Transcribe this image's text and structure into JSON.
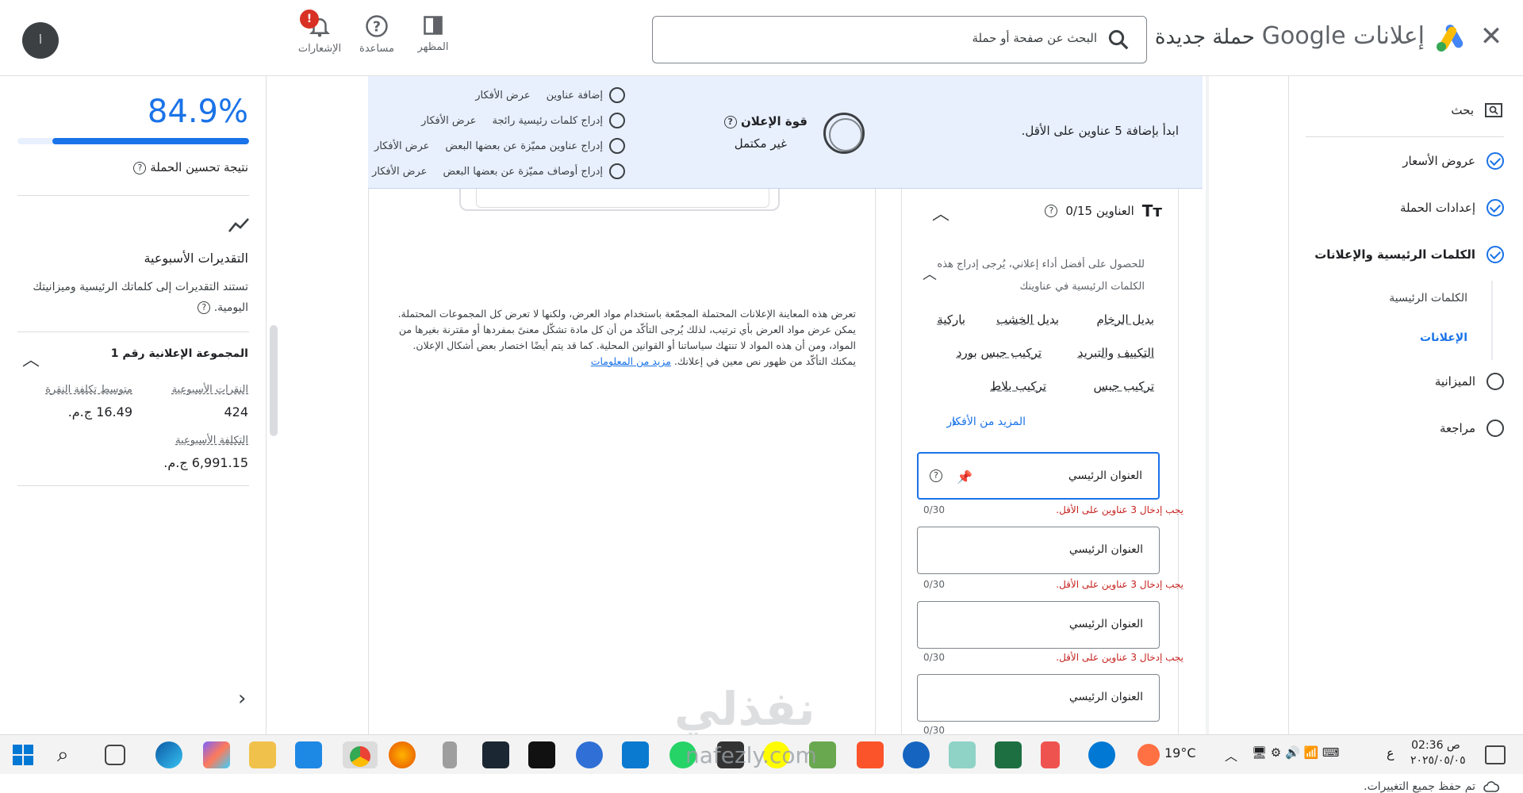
{
  "header": {
    "brand_google": "Google",
    "brand_product": "إعلانات",
    "page_title": "حملة جديدة",
    "search_placeholder": "البحث عن صفحة أو حملة",
    "tools": [
      {
        "label": "المظهر",
        "icon": "appearance-icon"
      },
      {
        "label": "مساعدة",
        "icon": "help-icon"
      },
      {
        "label": "الإشعارات",
        "icon": "bell-icon"
      }
    ],
    "notification_badge": "!",
    "avatar_initials": "أ"
  },
  "nav": {
    "items": [
      {
        "label": "بحث",
        "state": "search"
      },
      {
        "label": "عروض الأسعار",
        "state": "done"
      },
      {
        "label": "إعدادات الحملة",
        "state": "done"
      },
      {
        "label": "الكلمات الرئيسية والإعلانات",
        "state": "current"
      },
      {
        "label": "الميزانية",
        "state": "todo"
      },
      {
        "label": "مراجعة",
        "state": "todo"
      }
    ],
    "subitems": [
      {
        "label": "الكلمات الرئيسية",
        "active": false
      },
      {
        "label": "الإعلانات",
        "active": true
      }
    ],
    "saved_text": "تم حفظ جميع التغييرات."
  },
  "sidebar": {
    "optimization_score": "84.9%",
    "optimization_score_value": 84.9,
    "optimization_label": "نتيجة تحسين الحملة",
    "weekly_title": "التقديرات الأسبوعية",
    "weekly_desc_line1": "تستند التقديرات إلى كلماتك الرئيسية وميزانيتك",
    "weekly_desc_line2": "اليومية.",
    "ad_group": "المجموعة الإعلانية رقم 1",
    "stats": [
      {
        "label": "النقرات الأسبوعية",
        "value": "424"
      },
      {
        "label": "متوسط تكلفة النقرة",
        "value": "16.49 ج.م."
      },
      {
        "label": "التكلفة الأسبوعية",
        "value": "6,991.15 ج.م."
      }
    ]
  },
  "banner": {
    "start_text": "ابدأ بإضافة 5 عناوين على الأقل.",
    "strength_title": "قوة الإعلان",
    "strength_value": "غير مكتمل",
    "suggestions": [
      {
        "text": "إضافة عناوين",
        "link": "عرض الأفكار"
      },
      {
        "text": "إدراج كلمات رئيسية رائجة",
        "link": "عرض الأفكار"
      },
      {
        "text": "إدراج عناوين مميّزة عن بعضها البعض",
        "link": "عرض الأفكار"
      },
      {
        "text": "إدراج أوصاف مميّزة عن بعضها البعض",
        "link": "عرض الأفكار"
      }
    ]
  },
  "preview": {
    "disclaimer": "تعرض هذه المعاينة الإعلانات المحتملة المجمّعة باستخدام مواد العرض، ولكنها لا تعرض كل المجموعات المحتملة. يمكن عرض مواد العرض بأي ترتيب، لذلك يُرجى التأكّد من أن كل مادة تشكّل معنىً بمفردها أو مقترنة بغيرها من المواد، ومن أن هذه المواد لا تنتهك سياساتنا أو القوانين المحلية. كما قد يتم أيضًا اختصار بعض أشكال الإعلان. يمكنك التأكّد من ظهور نص معين في إعلانك.",
    "more_info": "مزيد من المعلومات"
  },
  "headlines": {
    "title": "العناوين 0/15",
    "hint": "للحصول على أفضل أداء إعلاني، يُرجى إدراج هذه الكلمات الرئيسية في عناوينك",
    "keywords": [
      "بديل الرخام",
      "بديل الخشب",
      "باركية",
      "التكييف والتبريد",
      "تركيب جبس بورد",
      "تركيب جبس",
      "تركيب بلاط"
    ],
    "more_ideas": "المزيد من الأفكار",
    "fields": [
      {
        "placeholder": "العنوان الرئيسي",
        "error": "يجب إدخال 3 عناوين على الأقل.",
        "counter": "0/30"
      },
      {
        "placeholder": "العنوان الرئيسي",
        "error": "يجب إدخال 3 عناوين على الأقل.",
        "counter": "0/30"
      },
      {
        "placeholder": "العنوان الرئيسي",
        "error": "يجب إدخال 3 عناوين على الأقل.",
        "counter": "0/30"
      },
      {
        "placeholder": "العنوان الرئيسي",
        "counter": "0/30"
      }
    ]
  },
  "watermark": {
    "arabic": "نفذلي",
    "latin": "nafezly.com"
  },
  "taskbar": {
    "temperature": "19°C",
    "lang": "ع",
    "time": "02:36 ص",
    "date": "٢٠٢٥/٠٥/٠٥"
  },
  "colors": {
    "accent": "#1a73e8",
    "error": "#c5221f",
    "banner": "#e8f0fe"
  }
}
